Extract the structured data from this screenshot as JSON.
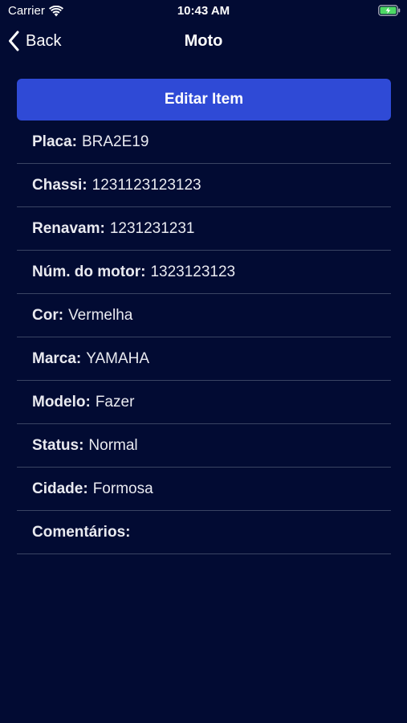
{
  "status_bar": {
    "carrier": "Carrier",
    "time": "10:43 AM",
    "battery_color": "#4cd964"
  },
  "nav": {
    "back_label": "Back",
    "title": "Moto"
  },
  "edit_button": {
    "label": "Editar Item",
    "color": "#2f4ad6"
  },
  "details": [
    {
      "label": "Placa:",
      "value": "BRA2E19"
    },
    {
      "label": "Chassi:",
      "value": "1231123123123"
    },
    {
      "label": "Renavam:",
      "value": "1231231231"
    },
    {
      "label": "Núm. do motor:",
      "value": "1323123123"
    },
    {
      "label": "Cor:",
      "value": "Vermelha"
    },
    {
      "label": "Marca:",
      "value": "YAMAHA"
    },
    {
      "label": "Modelo:",
      "value": "Fazer"
    },
    {
      "label": "Status:",
      "value": "Normal"
    },
    {
      "label": "Cidade:",
      "value": "Formosa"
    },
    {
      "label": "Comentários:",
      "value": ""
    }
  ],
  "theme": {
    "background": "#020b33",
    "separator": "#3a4463"
  }
}
